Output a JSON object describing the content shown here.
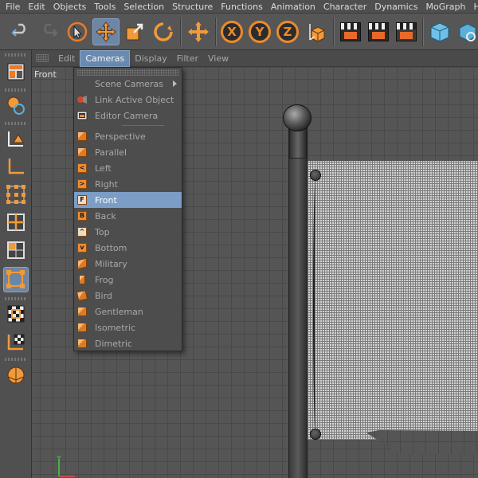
{
  "menubar": {
    "items": [
      "File",
      "Edit",
      "Objects",
      "Tools",
      "Selection",
      "Structure",
      "Functions",
      "Animation",
      "Character",
      "Dynamics",
      "MoGraph",
      "Hair"
    ]
  },
  "toolbar": {
    "icons": [
      "undo-icon",
      "redo-icon",
      "live-selection-icon",
      "move-icon",
      "scale-icon",
      "rotate-icon",
      "add-axis-icon",
      "x-axis-lock-icon",
      "y-axis-lock-icon",
      "z-axis-lock-icon",
      "coordinate-system-icon",
      "render-view-icon",
      "render-picture-viewer-icon",
      "render-settings-icon",
      "cube-primitive-icon",
      "spline-icon"
    ],
    "axis_labels": {
      "x": "X",
      "y": "Y",
      "z": "Z"
    }
  },
  "viewport": {
    "menus": [
      "Edit",
      "Cameras",
      "Display",
      "Filter",
      "View"
    ],
    "open_menu": "Cameras",
    "view_label": "Front"
  },
  "cameras_menu": {
    "group1": [
      {
        "label": "Scene Cameras",
        "icon": "none",
        "submenu": true
      },
      {
        "label": "Link Active Object",
        "icon": "link-object-icon"
      },
      {
        "label": "Editor Camera",
        "icon": "editor-camera-icon"
      }
    ],
    "group2": [
      {
        "label": "Perspective",
        "icon": "perspective-icon",
        "glyph": ""
      },
      {
        "label": "Parallel",
        "icon": "parallel-icon",
        "glyph": ""
      },
      {
        "label": "Left",
        "icon": "left-view-icon",
        "glyph": "<"
      },
      {
        "label": "Right",
        "icon": "right-view-icon",
        "glyph": ">"
      },
      {
        "label": "Front",
        "icon": "front-view-icon",
        "glyph": "F",
        "highlighted": true
      },
      {
        "label": "Back",
        "icon": "back-view-icon",
        "glyph": "B"
      },
      {
        "label": "Top",
        "icon": "top-view-icon",
        "glyph": "^"
      },
      {
        "label": "Bottom",
        "icon": "bottom-view-icon",
        "glyph": "v"
      },
      {
        "label": "Military",
        "icon": "military-icon",
        "glyph": ""
      },
      {
        "label": "Frog",
        "icon": "frog-icon",
        "glyph": ""
      },
      {
        "label": "Bird",
        "icon": "bird-icon",
        "glyph": ""
      },
      {
        "label": "Gentleman",
        "icon": "gentleman-icon",
        "glyph": ""
      },
      {
        "label": "Isometric",
        "icon": "isometric-icon",
        "glyph": ""
      },
      {
        "label": "Dimetric",
        "icon": "dimetric-icon",
        "glyph": ""
      }
    ]
  },
  "colors": {
    "accent_orange": "#ec8c33",
    "highlight_blue": "#7b9dc6",
    "active_tool": "#6d86a6",
    "ui_gray": "#4d4d4d"
  }
}
